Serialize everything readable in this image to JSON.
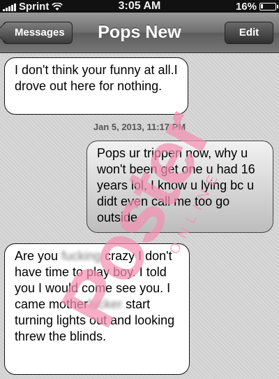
{
  "status_bar": {
    "carrier": "Sprint",
    "time": "3:05 AM",
    "battery": "16%",
    "battery_level": 0.16,
    "icons": [
      "signal-icon",
      "wifi-icon",
      "battery-icon"
    ]
  },
  "nav": {
    "back_label": "Messages",
    "title": "Pops New",
    "edit_label": "Edit"
  },
  "messages": [
    {
      "direction": "incoming",
      "text": "I don't think your funny at all.I drove out here for nothing."
    },
    {
      "direction": "outgoing",
      "text": "Pops ur trippen now, why u won't been get one u had 16 years lol, I know u lying bc u didt even call me too go outside"
    },
    {
      "direction": "incoming",
      "text_parts": [
        "Are you ",
        "fucking",
        " crazy I don't have time to play boy. I told you I would come see you. I came mother",
        "fucker",
        " start turning lights out and looking threw the blinds."
      ]
    }
  ],
  "timestamp": "Jan 5, 2013, 11:17 PM",
  "watermark": {
    "text": "Poster",
    "subtext": "ONLINE",
    "color": "#f48fb1"
  }
}
